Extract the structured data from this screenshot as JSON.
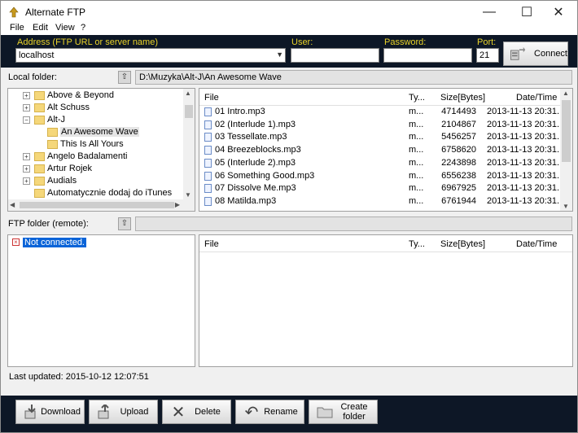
{
  "window": {
    "title": "Alternate FTP",
    "minimize": "—",
    "maximize": "☐",
    "close": "✕"
  },
  "menu": {
    "file": "File",
    "edit": "Edit",
    "view": "View",
    "help": "?"
  },
  "connection": {
    "address_label": "Address (FTP URL or server name)",
    "address_value": "localhost",
    "user_label": "User:",
    "user_value": "",
    "password_label": "Password:",
    "password_value": "",
    "port_label": "Port:",
    "port_value": "21",
    "connect_label": "Connect"
  },
  "local": {
    "label": "Local folder:",
    "path": "D:\\Muzyka\\Alt-J\\An Awesome Wave",
    "tree": [
      {
        "label": "Above & Beyond",
        "expander": "+"
      },
      {
        "label": "Alt Schuss",
        "expander": "+"
      },
      {
        "label": "Alt-J",
        "expander": "−"
      },
      {
        "label": "An Awesome Wave",
        "expander": ""
      },
      {
        "label": "This Is All Yours",
        "expander": ""
      },
      {
        "label": "Angelo Badalamenti",
        "expander": "+"
      },
      {
        "label": "Artur Rojek",
        "expander": "+"
      },
      {
        "label": "Audials",
        "expander": "+"
      },
      {
        "label": "Automatycznie dodaj do iTunes",
        "expander": ""
      }
    ],
    "columns": {
      "file": "File",
      "type": "Ty...",
      "size": "Size[Bytes]",
      "date": "Date/Time"
    },
    "files": [
      {
        "name": "01 Intro.mp3",
        "type": "m...",
        "size": "4714493",
        "date": "2013-11-13 20:31..."
      },
      {
        "name": "02 (Interlude 1).mp3",
        "type": "m...",
        "size": "2104867",
        "date": "2013-11-13 20:31..."
      },
      {
        "name": "03 Tessellate.mp3",
        "type": "m...",
        "size": "5456257",
        "date": "2013-11-13 20:31..."
      },
      {
        "name": "04 Breezeblocks.mp3",
        "type": "m...",
        "size": "6758620",
        "date": "2013-11-13 20:31..."
      },
      {
        "name": "05 (Interlude 2).mp3",
        "type": "m...",
        "size": "2243898",
        "date": "2013-11-13 20:31..."
      },
      {
        "name": "06 Something Good.mp3",
        "type": "m...",
        "size": "6556238",
        "date": "2013-11-13 20:31..."
      },
      {
        "name": "07 Dissolve Me.mp3",
        "type": "m...",
        "size": "6967925",
        "date": "2013-11-13 20:31..."
      },
      {
        "name": "08 Matilda.mp3",
        "type": "m...",
        "size": "6761944",
        "date": "2013-11-13 20:31..."
      }
    ]
  },
  "remote": {
    "label": "FTP folder (remote):",
    "path": "",
    "tree_status": "Not connected.",
    "columns": {
      "file": "File",
      "type": "Ty...",
      "size": "Size[Bytes]",
      "date": "Date/Time"
    }
  },
  "status": {
    "last_updated": "Last updated: 2015-10-12 12:07:51"
  },
  "actions": {
    "download": "Download",
    "upload": "Upload",
    "delete": "Delete",
    "rename": "Rename",
    "create_folder": "Create folder"
  }
}
